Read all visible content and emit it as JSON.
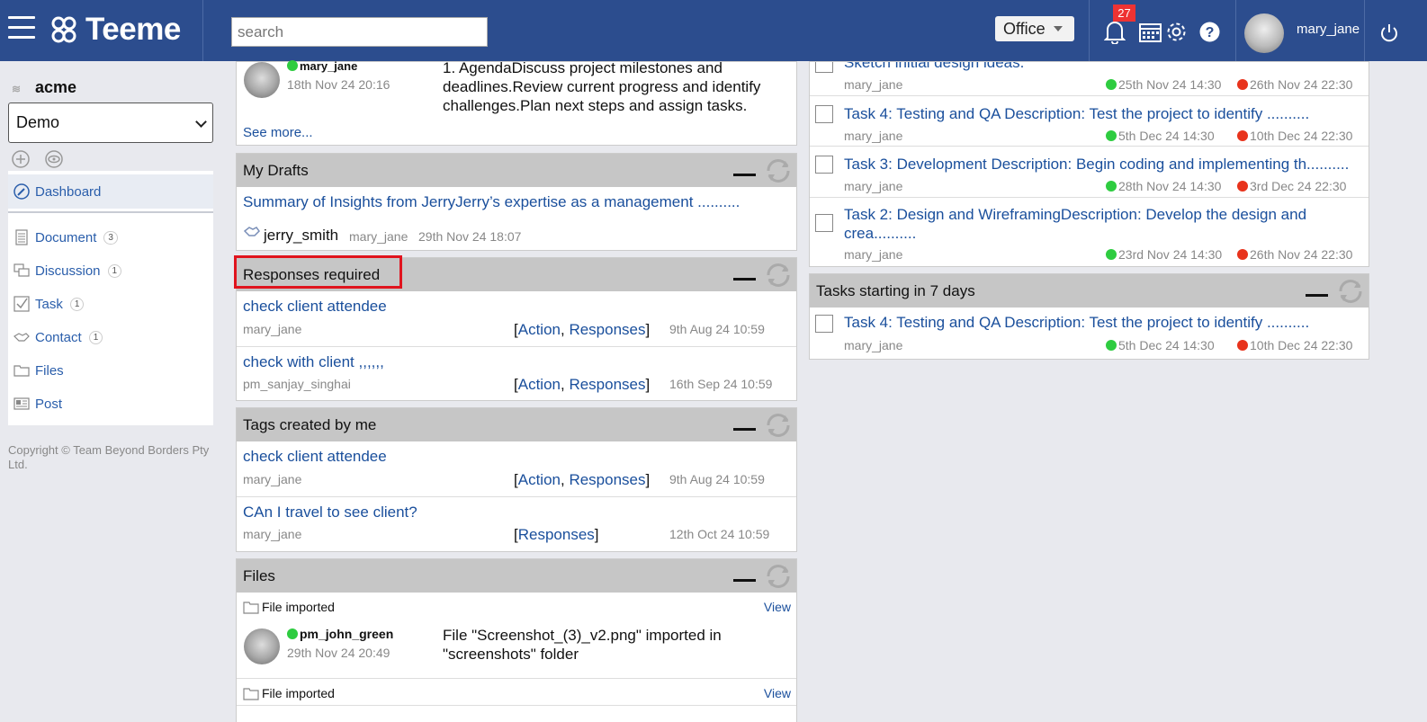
{
  "header": {
    "brand": "Teeme",
    "search_placeholder": "search",
    "workspace": "Office",
    "notification_count": "27",
    "username": "mary_jane"
  },
  "sidebar": {
    "org": "acme",
    "selected": "Demo",
    "dashboard": "Dashboard",
    "items": [
      {
        "label": "Document",
        "count": "3"
      },
      {
        "label": "Discussion",
        "count": "1"
      },
      {
        "label": "Task",
        "count": "1"
      },
      {
        "label": "Contact",
        "count": "1"
      },
      {
        "label": "Files",
        "count": ""
      },
      {
        "label": "Post",
        "count": ""
      }
    ],
    "copyright": "Copyright © Team Beyond Borders Pty Ltd."
  },
  "top_panel": {
    "user": "mary_jane",
    "date": "18th Nov 24 20:16",
    "text": "1. AgendaDiscuss project milestones and deadlines.Review current progress and identify challenges.Plan next steps and assign tasks.",
    "see_more": "See more..."
  },
  "drafts": {
    "title": "My Drafts",
    "item_title": "Summary of Insights from JerryJerry’s expertise as a management ..........",
    "contact": "jerry_smith",
    "author": "mary_jane",
    "date": "29th Nov 24 18:07"
  },
  "responses": {
    "title": "Responses required",
    "rows": [
      {
        "title": "check client attendee",
        "user": "mary_jane",
        "action": "Action",
        "responses": "Responses",
        "date": "9th Aug 24 10:59"
      },
      {
        "title": "check with client ,,,,,,",
        "user": "pm_sanjay_singhai",
        "action": "Action",
        "responses": "Responses",
        "date": "16th Sep 24 10:59"
      }
    ]
  },
  "tags": {
    "title": "Tags created by me",
    "rows": [
      {
        "title": "check client attendee",
        "user": "mary_jane",
        "action": "Action",
        "responses": "Responses",
        "date": "9th Aug 24 10:59"
      },
      {
        "title": "CAn I travel to see client?",
        "user": "mary_jane",
        "responses": "Responses",
        "date": "12th Oct 24 10:59"
      }
    ]
  },
  "files": {
    "title": "Files",
    "rows": [
      {
        "label": "File imported",
        "view": "View",
        "user": "pm_john_green",
        "date": "29th Nov 24 20:49",
        "text": "File \"Screenshot_(3)_v2.png\" imported in \"screenshots\" folder"
      },
      {
        "label": "File imported",
        "view": "View"
      }
    ]
  },
  "tasks": {
    "partial_title": "Sketch initial design ideas.",
    "rows": [
      {
        "title": "Task 4: Testing and QA Description: Test the project to identify ..........",
        "user": "mary_jane",
        "start": "5th Dec 24 14:30",
        "end": "10th Dec 24 22:30"
      },
      {
        "title": "Task 3: Development Description: Begin coding and implementing th..........",
        "user": "mary_jane",
        "start": "28th Nov 24 14:30",
        "end": "3rd Dec 24 22:30"
      },
      {
        "title": "Task 2: Design and WireframingDescription: Develop the design and crea..........",
        "user": "mary_jane",
        "start": "23rd Nov 24 14:30",
        "end": "26th Nov 24 22:30"
      }
    ],
    "first_row": {
      "user": "mary_jane",
      "start": "25th Nov 24 14:30",
      "end": "26th Nov 24 22:30"
    }
  },
  "tasks7": {
    "title": "Tasks starting in 7 days",
    "row": {
      "title": "Task 4: Testing and QA Description: Test the project to identify ..........",
      "user": "mary_jane",
      "start": "5th Dec 24 14:30",
      "end": "10th Dec 24 22:30"
    }
  }
}
